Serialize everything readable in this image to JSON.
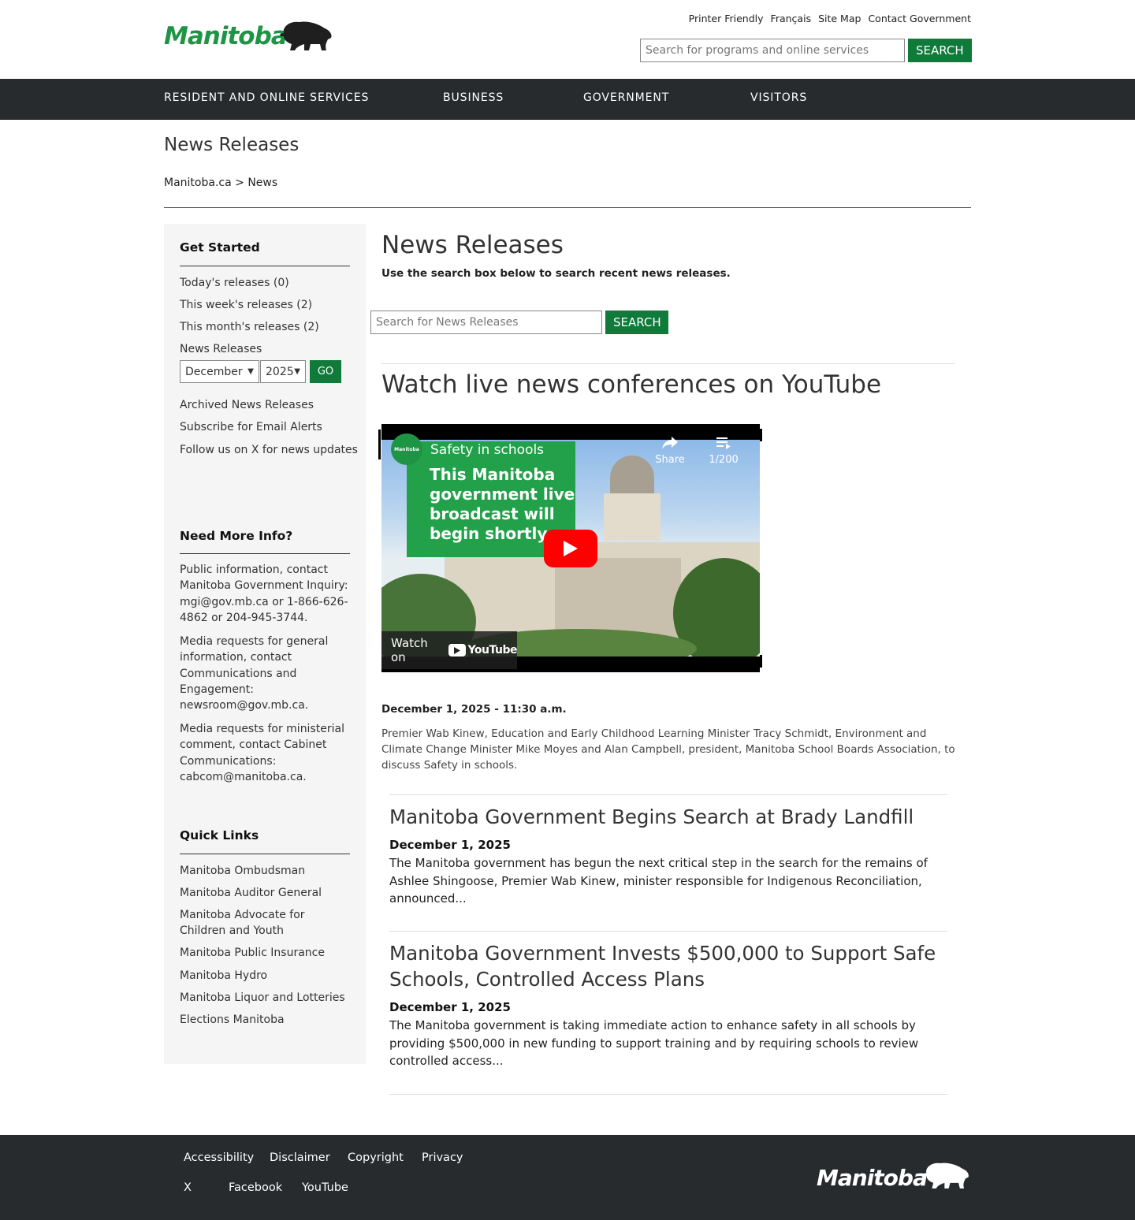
{
  "header": {
    "logo_text": "Manitoba",
    "util_links": [
      "Printer Friendly",
      "Français",
      "Site Map",
      "Contact Government"
    ],
    "search_placeholder": "Search for programs and online services",
    "search_button": "SEARCH"
  },
  "nav": {
    "items": [
      "RESIDENT AND ONLINE SERVICES",
      "BUSINESS",
      "GOVERNMENT",
      "VISITORS"
    ]
  },
  "page": {
    "title": "News Releases",
    "breadcrumb_home": "Manitoba.ca",
    "breadcrumb_sep": ">",
    "breadcrumb_current": "News"
  },
  "sidebar": {
    "get_started": {
      "heading": "Get Started",
      "links": [
        "Today's releases (0)",
        "This week's releases (2)",
        "This month's releases (2)"
      ],
      "archive_label": "News Releases",
      "month_value": "December",
      "year_value": "2025",
      "go_label": "GO",
      "more_links": [
        "Archived News Releases",
        "Subscribe for Email Alerts",
        "Follow us on X for news updates"
      ]
    },
    "more_info": {
      "heading": "Need More Info?",
      "paragraphs": [
        "Public information, contact Manitoba Government Inquiry: mgi@gov.mb.ca or 1-866-626-4862 or 204-945-3744.",
        "Media requests for general information, contact Communications and Engagement: newsroom@gov.mb.ca.",
        "Media requests for ministerial comment, contact Cabinet Communications: cabcom@manitoba.ca."
      ]
    },
    "quick_links": {
      "heading": "Quick Links",
      "links": [
        "Manitoba Ombudsman",
        "Manitoba Auditor General",
        "Manitoba Advocate for Children and Youth",
        "Manitoba Public Insurance",
        "Manitoba Hydro",
        "Manitoba Liquor and Lotteries",
        "Elections Manitoba"
      ]
    }
  },
  "main": {
    "title": "News Releases",
    "subtitle": "Use the search box below to search recent news releases.",
    "search_placeholder": "Search for News Releases",
    "search_button": "SEARCH",
    "youtube_heading": "Watch live news conferences on YouTube",
    "video": {
      "title": "Safety in schools",
      "overlay_text": "This Manitoba government live broadcast will begin shortly.",
      "channel": "Manitoba",
      "share_label": "Share",
      "playlist_count": "1/200",
      "watch_on": "Watch on",
      "youtube_label": "YouTube"
    },
    "event_date": "December 1, 2025 - 11:30 a.m.",
    "event_desc": "Premier Wab Kinew, Education and Early Childhood Learning Minister Tracy Schmidt, Environment and Climate Change Minister Mike Moyes and Alan Campbell, president, Manitoba School Boards Association, to discuss Safety in schools.",
    "articles": [
      {
        "title": "Manitoba Government Begins Search at Brady Landfill",
        "date": "December 1, 2025",
        "body": "The Manitoba government has begun the next critical step in the search for the remains of Ashlee Shingoose, Premier Wab Kinew, minister responsible for Indigenous Reconciliation, announced..."
      },
      {
        "title": "Manitoba Government Invests $500,000 to Support Safe Schools, Controlled Access Plans",
        "date": "December 1, 2025",
        "body": "The Manitoba government is taking immediate action to enhance safety in all schools by providing $500,000 in new funding to support training and by requiring schools to review controlled access..."
      }
    ]
  },
  "footer": {
    "links_row1": [
      "Accessibility",
      "Disclaimer",
      "Copyright",
      "Privacy"
    ],
    "links_row2": [
      "X",
      "Facebook",
      "YouTube"
    ],
    "logo_text": "Manitoba"
  },
  "colors": {
    "brand_green": "#1e9445",
    "button_green": "#0f7a3a",
    "nav_dark": "#272b2e",
    "sidebar_bg": "#f5f5f5"
  }
}
